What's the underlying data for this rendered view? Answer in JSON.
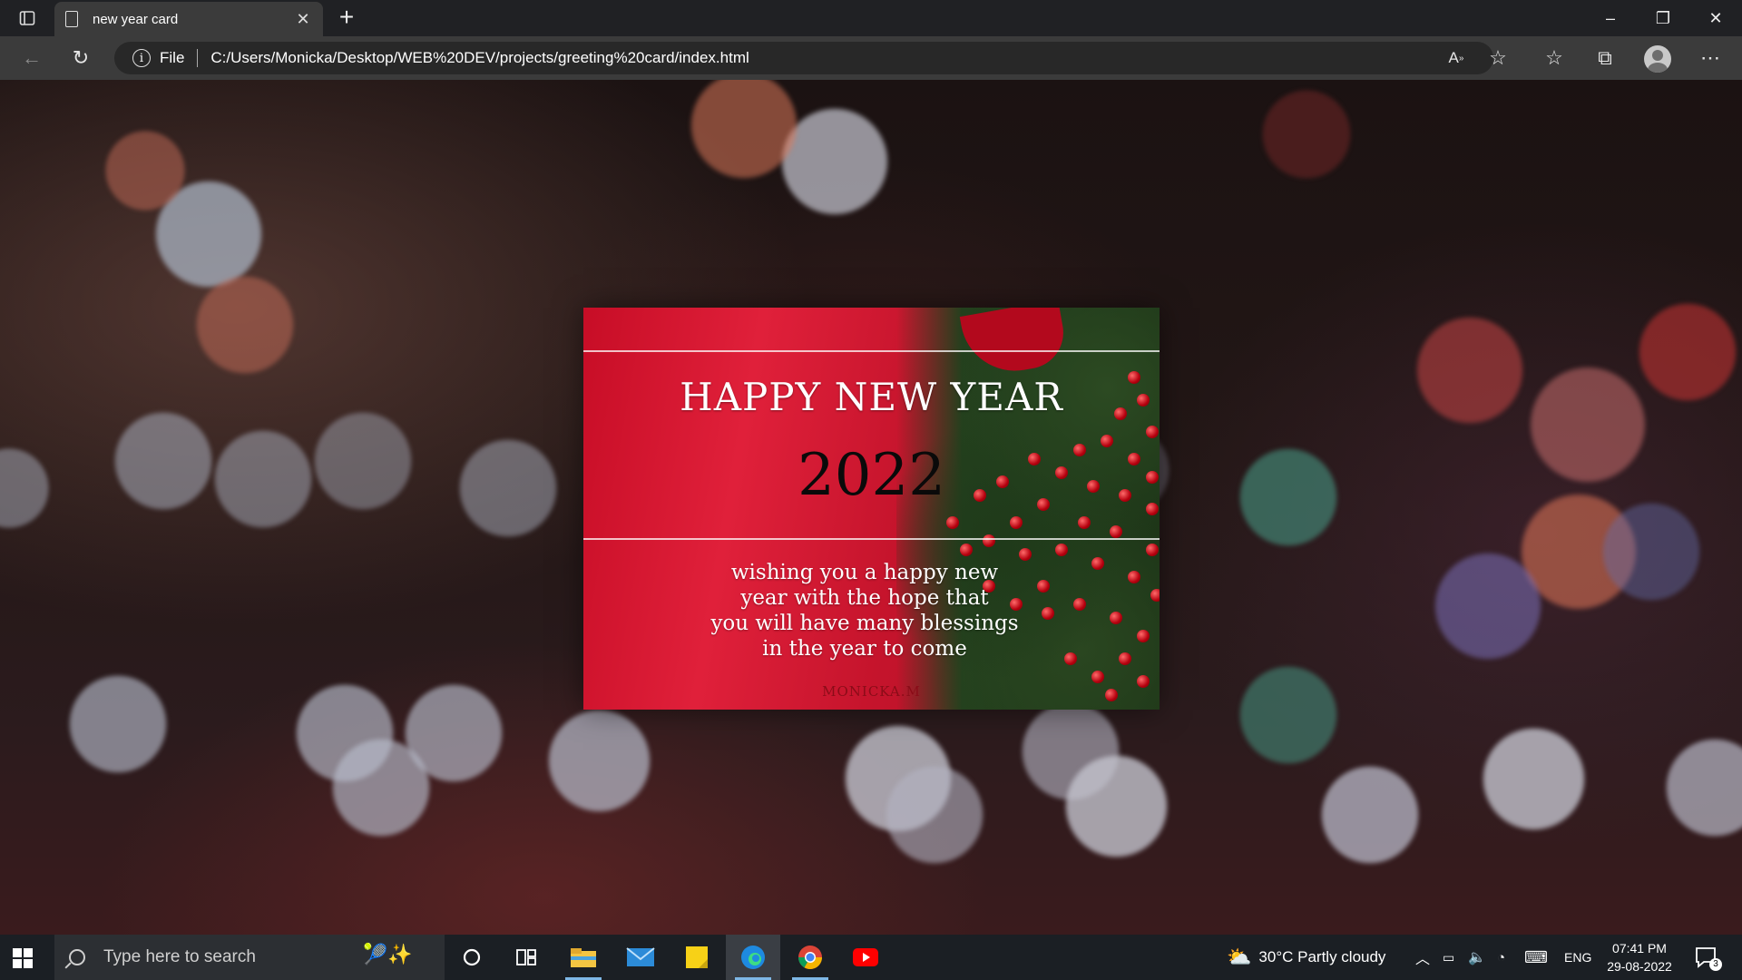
{
  "browser": {
    "tab_title": "new year card",
    "address_scheme": "File",
    "address_url": "C:/Users/Monicka/Desktop/WEB%20DEV/projects/greeting%20card/index.html"
  },
  "icons": {
    "tab_actions": "tab-actions-icon",
    "page": "page-icon",
    "tab_close": "close-icon",
    "new_tab": "plus-icon",
    "minimize": "minimize-icon",
    "restore": "restore-icon",
    "close": "close-icon",
    "back": "arrow-left-icon",
    "refresh": "refresh-icon",
    "info": "info-icon",
    "read_aloud": "read-aloud-icon",
    "add_favorite": "star-add-icon",
    "favorites": "favorites-icon",
    "collections": "collections-icon",
    "profile": "avatar-icon",
    "more": "more-icon"
  },
  "card": {
    "headline": "HAPPY NEW YEAR",
    "year": "2022",
    "message_lines": [
      "wishing you a happy new",
      "year with the hope that",
      "you will have many blessings",
      "in the year to come"
    ],
    "signature": "MONICKA.M",
    "colors": {
      "card_red": "#e0203a",
      "greenery": "#23401d",
      "berry": "#b5000e"
    }
  },
  "taskbar": {
    "search_placeholder": "Type here to search",
    "apps": [
      "cortana-circle-icon",
      "task-view-icon",
      "file-explorer-icon",
      "mail-icon",
      "sticky-notes-icon",
      "edge-icon",
      "chrome-icon",
      "youtube-icon"
    ],
    "active_app": "edge-icon",
    "weather": "30°C  Partly cloudy",
    "language": "ENG",
    "time": "07:41 PM",
    "date": "29-08-2022",
    "notification_count": "3"
  }
}
